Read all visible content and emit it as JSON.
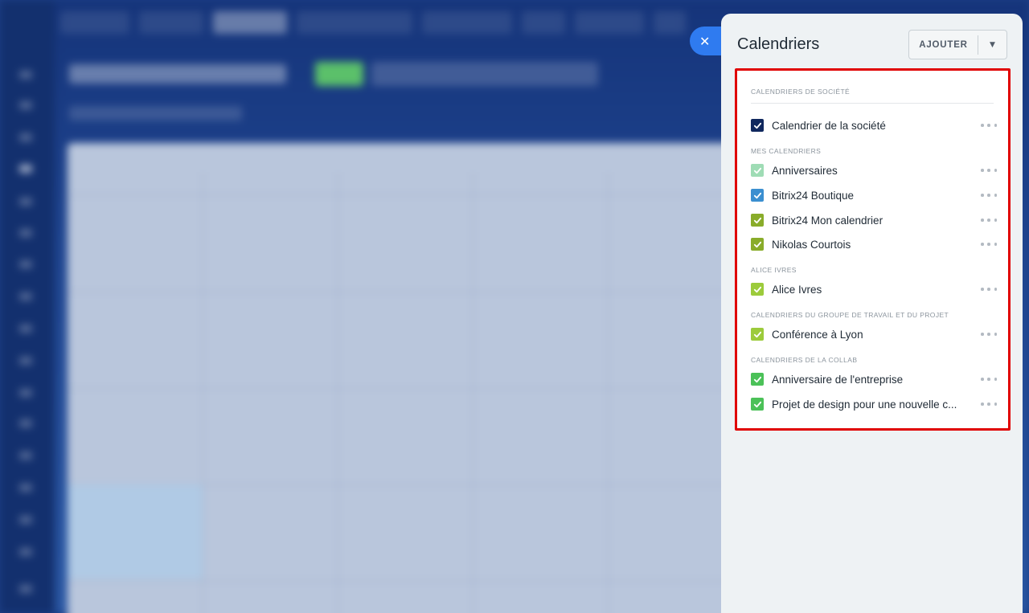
{
  "panel": {
    "title": "Calendriers",
    "add_button_label": "AJOUTER"
  },
  "colors": {
    "navy": "#10285e",
    "mint": "#9fdcb5",
    "blue": "#3b8fd0",
    "olive": "#89ac2a",
    "lime": "#9ccb3b",
    "green": "#4bc158",
    "highlight_border": "#e00000",
    "close_button": "#2f7bf0"
  },
  "sections": [
    {
      "title": "CALENDRIERS DE SOCIÉTÉ",
      "items": [
        {
          "name": "Calendrier de la société",
          "checked": true,
          "color": "#10285e"
        }
      ]
    },
    {
      "title": "MES CALENDRIERS",
      "items": [
        {
          "name": "Anniversaires",
          "checked": true,
          "color": "#9fdcb5"
        },
        {
          "name": "Bitrix24 Boutique",
          "checked": true,
          "color": "#3b8fd0"
        },
        {
          "name": "Bitrix24 Mon calendrier",
          "checked": true,
          "color": "#89ac2a"
        },
        {
          "name": "Nikolas Courtois",
          "checked": true,
          "color": "#89ac2a"
        }
      ]
    },
    {
      "title": "ALICE IVRES",
      "items": [
        {
          "name": "Alice Ivres",
          "checked": true,
          "color": "#9ccb3b"
        }
      ]
    },
    {
      "title": "CALENDRIERS DU GROUPE DE TRAVAIL ET DU PROJET",
      "items": [
        {
          "name": "Conférence à Lyon",
          "checked": true,
          "color": "#9ccb3b"
        }
      ]
    },
    {
      "title": "CALENDRIERS DE LA COLLAB",
      "items": [
        {
          "name": "Anniversaire de l'entreprise",
          "checked": true,
          "color": "#4bc158"
        },
        {
          "name": "Projet de design pour une nouvelle c...",
          "checked": true,
          "color": "#4bc158"
        }
      ]
    }
  ]
}
